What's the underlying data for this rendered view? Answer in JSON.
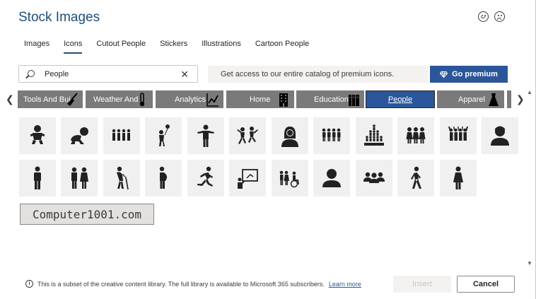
{
  "dialog": {
    "title": "Stock Images"
  },
  "tabs": [
    {
      "label": "Images",
      "active": false
    },
    {
      "label": "Icons",
      "active": true
    },
    {
      "label": "Cutout People",
      "active": false
    },
    {
      "label": "Stickers",
      "active": false
    },
    {
      "label": "Illustrations",
      "active": false
    },
    {
      "label": "Cartoon People",
      "active": false
    }
  ],
  "search": {
    "value": "People",
    "clear_glyph": "✕"
  },
  "promo": {
    "text": "Get access to our entire catalog of premium icons.",
    "button_label": "Go premium"
  },
  "categories": [
    {
      "label": "Tools And Bui",
      "icon": "broom-icon",
      "selected": false
    },
    {
      "label": "Weather And",
      "icon": "thermometer-icon",
      "selected": false
    },
    {
      "label": "Analytics",
      "icon": "line-chart-icon",
      "selected": false
    },
    {
      "label": "Home",
      "icon": "building-icon",
      "selected": false
    },
    {
      "label": "Education",
      "icon": "books-icon",
      "selected": false
    },
    {
      "label": "People",
      "icon": "",
      "selected": true
    },
    {
      "label": "Apparel",
      "icon": "dress-icon",
      "selected": false
    }
  ],
  "carousel": {
    "prev_glyph": "❮",
    "next_glyph": "❯"
  },
  "icons": [
    "baby-icon",
    "crawling-baby-icon",
    "family-group-icon",
    "child-with-balloon-icon",
    "man-pointing-icon",
    "dancing-people-icon",
    "woman-headset-icon",
    "group-of-people-icon",
    "crowd-pyramid-icon",
    "women-group-icon",
    "cheering-crowd-icon",
    "user-avatar-icon",
    "man-icon",
    "man-and-woman-icon",
    "elderly-person-with-cane-icon",
    "pregnant-woman-icon",
    "running-person-icon",
    "presenter-icon",
    "family-with-wheelchair-icon",
    "user-icon",
    "users-group-icon",
    "walking-person-icon",
    "woman-icon"
  ],
  "watermark": {
    "text": "Computer1001.com"
  },
  "footer": {
    "info_text": "This is a subset of the creative content library. The full library is available to Microsoft 365 subscribers.",
    "learn_more": "Learn more",
    "insert_label": "Insert",
    "cancel_label": "Cancel"
  },
  "colors": {
    "accent": "#2b579a",
    "title": "#1e4e79",
    "chip": "#7a7a7a",
    "tile": "#f0f0f0"
  }
}
